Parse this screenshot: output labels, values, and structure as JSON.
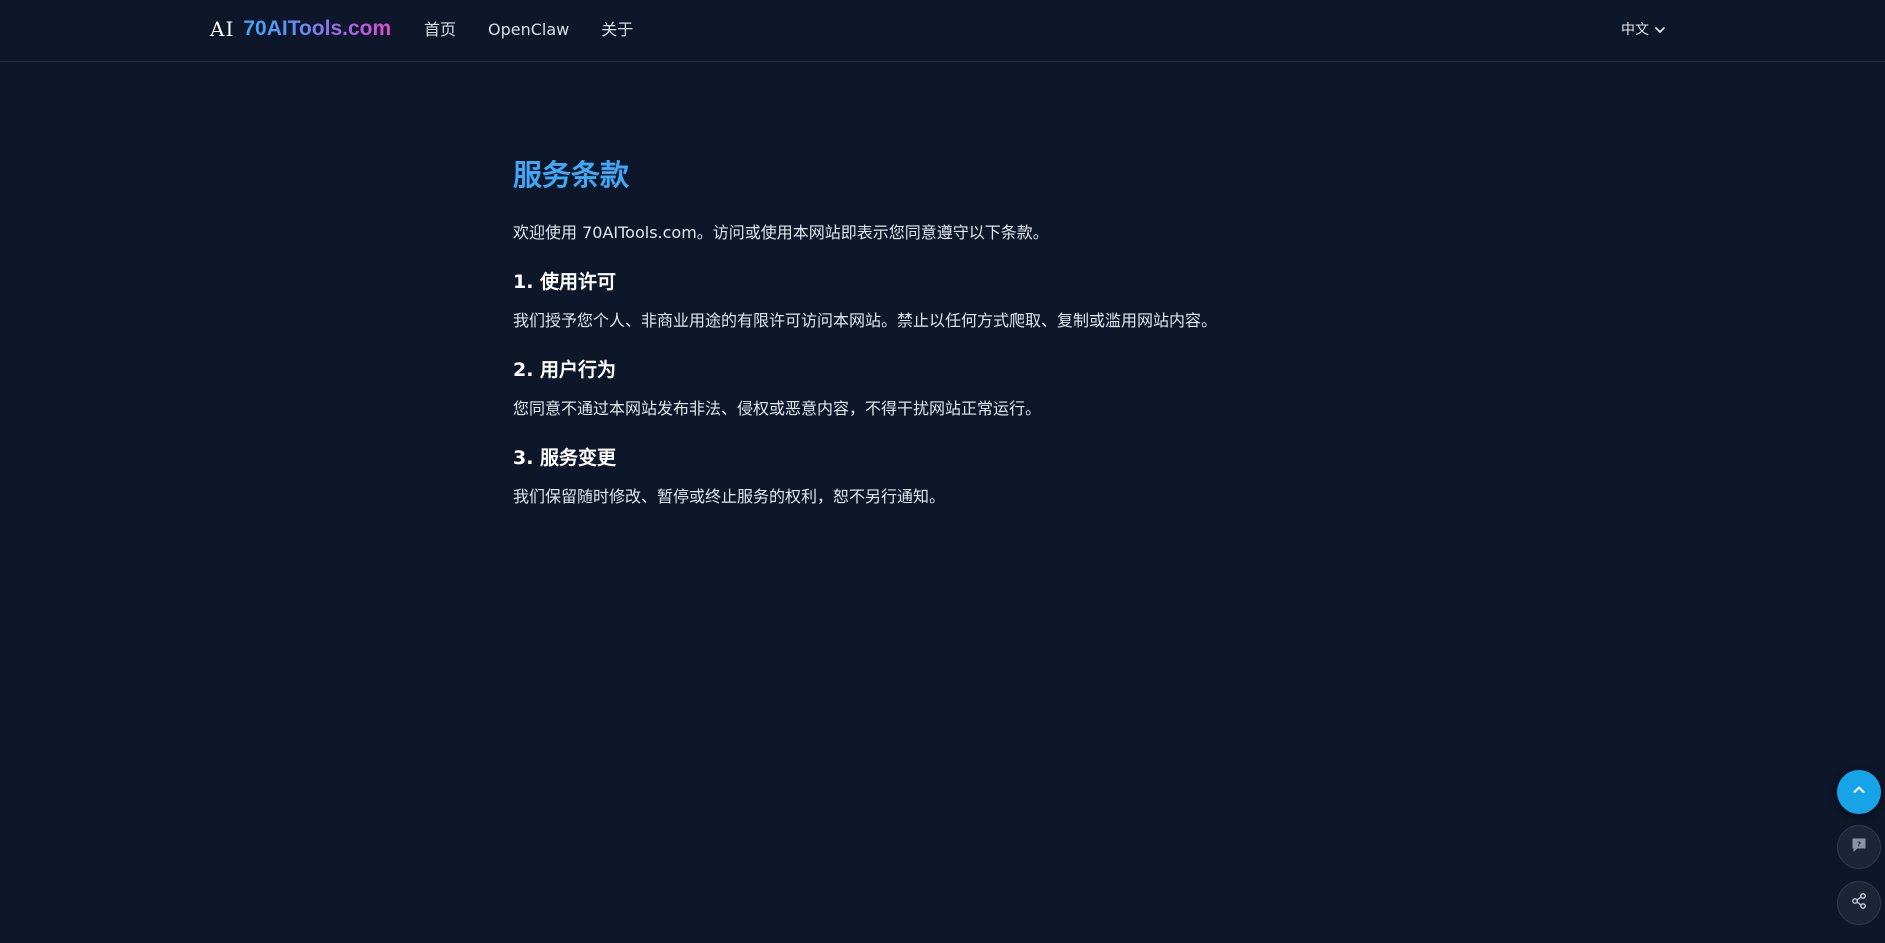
{
  "header": {
    "logo_mark": "AI",
    "logo_text": "70AITools.com",
    "nav": [
      {
        "label": "首页"
      },
      {
        "label": "OpenClaw"
      },
      {
        "label": "关于"
      }
    ],
    "language": "中文"
  },
  "main": {
    "title": "服务条款",
    "intro": "欢迎使用 70AITools.com。访问或使用本网站即表示您同意遵守以下条款。",
    "sections": [
      {
        "heading": "1. 使用许可",
        "body": "我们授予您个人、非商业用途的有限许可访问本网站。禁止以任何方式爬取、复制或滥用网站内容。"
      },
      {
        "heading": "2. 用户行为",
        "body": "您同意不通过本网站发布非法、侵权或恶意内容，不得干扰网站正常运行。"
      },
      {
        "heading": "3. 服务变更",
        "body": "我们保留随时修改、暂停或终止服务的权利，恕不另行通知。"
      }
    ]
  },
  "floating_buttons": {
    "back_to_top_icon": "chevron-up-icon",
    "feedback_icon": "feedback-icon",
    "share_icon": "share-icon"
  },
  "colors": {
    "background": "#0e1629",
    "accent": "#3fa7f5",
    "fab_primary": "#16a3e8"
  }
}
